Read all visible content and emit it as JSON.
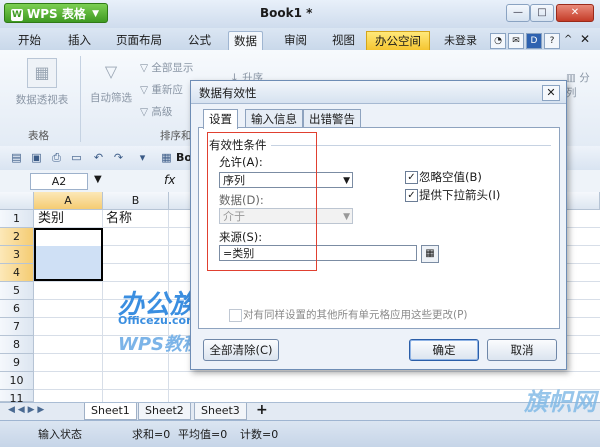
{
  "app": {
    "menu_button": "WPS 表格",
    "doc_title": "Book1 *",
    "login": "未登录"
  },
  "tabs": [
    "开始",
    "插入",
    "页面布局",
    "公式",
    "数据",
    "审阅",
    "视图",
    "办公空间"
  ],
  "ribbon": {
    "pivot": "数据透视表",
    "autofilter": "自动筛选",
    "show_all": "全部显示",
    "reapply": "重新应",
    "advanced": "高级",
    "sort_asc": "升序",
    "group_table": "表格",
    "group_sort": "排序和",
    "split": "分列"
  },
  "qat_doc": "Bo",
  "formula": {
    "name_box": "A2",
    "fx": "fx"
  },
  "grid": {
    "col_headers": [
      "A",
      "B"
    ],
    "row_headers": [
      "1",
      "2",
      "3",
      "4",
      "5",
      "6",
      "7",
      "8",
      "9",
      "10",
      "11"
    ],
    "a1": "类别",
    "b1": "名称"
  },
  "watermark": {
    "line1": "办公族",
    "line2": "Officezu.com",
    "line3": "WPS教程",
    "corner": "旗帜网"
  },
  "sheets": [
    "Sheet1",
    "Sheet2",
    "Sheet3"
  ],
  "status": {
    "mode": "输入状态",
    "sum": "求和=0",
    "avg": "平均值=0",
    "count": "计数=0"
  },
  "dialog": {
    "title": "数据有效性",
    "tabs": [
      "设置",
      "输入信息",
      "出错警告"
    ],
    "section_title": "有效性条件",
    "allow_label": "允许(A):",
    "allow_value": "序列",
    "data_label": "数据(D):",
    "data_value": "介于",
    "source_label": "来源(S):",
    "source_value": "=类别",
    "ignore_blank": "忽略空值(B)",
    "dropdown_arrow": "提供下拉箭头(I)",
    "apply_all": "对有同样设置的其他所有单元格应用这些更改(P)",
    "clear_all": "全部清除(C)",
    "ok": "确定",
    "cancel": "取消",
    "ignore_blank_checked": true,
    "dropdown_checked": true
  },
  "colors": {
    "accent": "#3f9a22",
    "selection": "#cfe0f5",
    "highlight_box": "#e04030"
  }
}
